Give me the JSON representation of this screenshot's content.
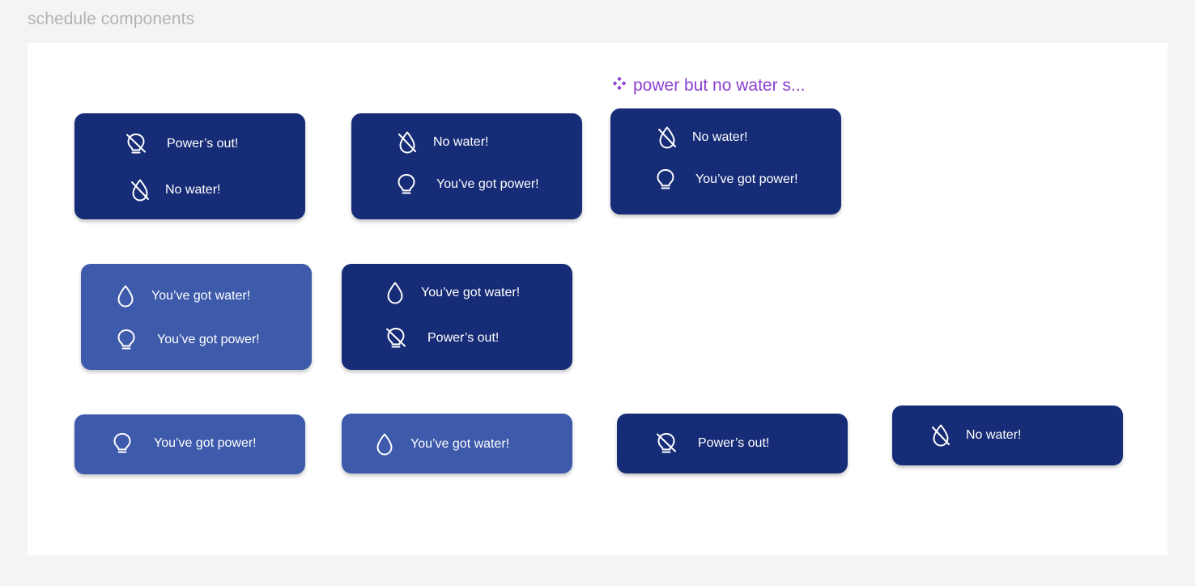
{
  "frame": {
    "title": "schedule components"
  },
  "component_label": {
    "icon": "component-diamond-icon",
    "text": "power but no water s..."
  },
  "colors": {
    "dark_card": "#172c77",
    "light_card": "#3d5aab",
    "component_purple": "#8a3fd1"
  },
  "cards": [
    {
      "variant": "dark",
      "rows": [
        {
          "icon": "power-off-icon",
          "text": "Power’s out!"
        },
        {
          "icon": "water-off-icon",
          "text": "No water!"
        }
      ]
    },
    {
      "variant": "dark",
      "rows": [
        {
          "icon": "water-off-icon",
          "text": "No water!"
        },
        {
          "icon": "bulb-icon",
          "text": "You’ve got power!"
        }
      ]
    },
    {
      "variant": "dark",
      "rows": [
        {
          "icon": "water-off-icon",
          "text": "No water!"
        },
        {
          "icon": "bulb-icon",
          "text": "You’ve got power!"
        }
      ]
    },
    {
      "variant": "light",
      "rows": [
        {
          "icon": "water-drop-icon",
          "text": "You’ve got water!"
        },
        {
          "icon": "bulb-icon",
          "text": "You’ve got power!"
        }
      ]
    },
    {
      "variant": "dark",
      "rows": [
        {
          "icon": "water-drop-icon",
          "text": "You’ve got water!"
        },
        {
          "icon": "power-off-icon",
          "text": "Power’s out!"
        }
      ]
    },
    {
      "variant": "light",
      "rows": [
        {
          "icon": "bulb-icon",
          "text": "You’ve got power!"
        }
      ]
    },
    {
      "variant": "light",
      "rows": [
        {
          "icon": "water-drop-icon",
          "text": "You’ve got water!"
        }
      ]
    },
    {
      "variant": "dark",
      "rows": [
        {
          "icon": "power-off-icon",
          "text": "Power’s out!"
        }
      ]
    },
    {
      "variant": "dark",
      "rows": [
        {
          "icon": "water-off-icon",
          "text": "No water!"
        }
      ]
    }
  ]
}
